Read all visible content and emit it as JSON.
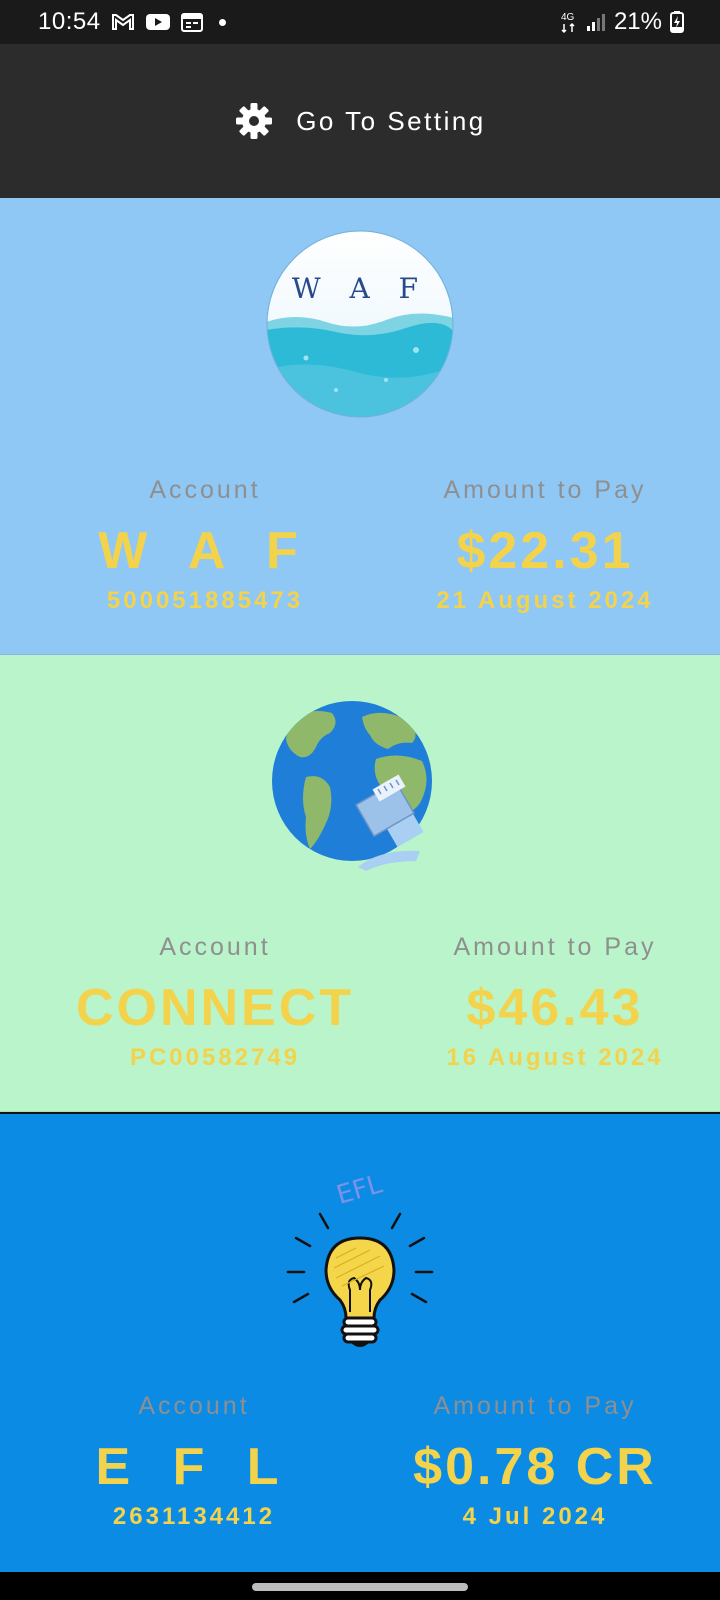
{
  "status": {
    "time": "10:54",
    "network": "4G",
    "battery": "21%"
  },
  "appbar": {
    "label": "Go To Setting",
    "icon": "gear-icon"
  },
  "colors": {
    "waf_bg": "#8fc7f5",
    "connect_bg": "#b9f4cb",
    "efl_bg": "#0b8be4",
    "accent_yellow": "#f3d34c",
    "label_gray": "#8f8f8f"
  },
  "accounts": [
    {
      "logo_text": "W A F",
      "account_label": "Account",
      "account_name": "W A F",
      "account_number": "500051885473",
      "amount_label": "Amount to Pay",
      "amount": "$22.31",
      "due_date": "21 August 2024"
    },
    {
      "logo_text": "",
      "account_label": "Account",
      "account_name": "CONNECT",
      "account_number": "PC00582749",
      "amount_label": "Amount to Pay",
      "amount": "$46.43",
      "due_date": "16 August 2024"
    },
    {
      "logo_text": "EFL",
      "account_label": "Account",
      "account_name": "E F L",
      "account_number": "2631134412",
      "amount_label": "Amount to Pay",
      "amount": "$0.78 CR",
      "due_date": "4 Jul 2024"
    }
  ]
}
